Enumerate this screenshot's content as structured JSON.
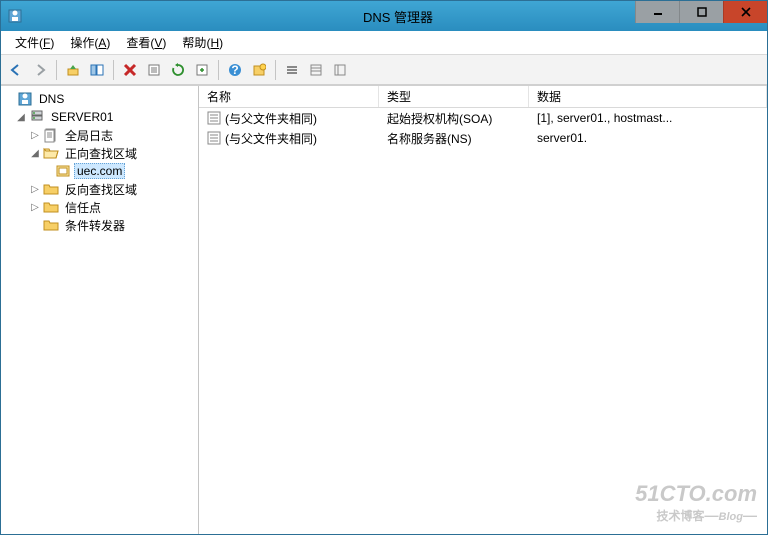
{
  "window": {
    "title": "DNS 管理器"
  },
  "menubar": {
    "file": {
      "label": "文件",
      "key": "F"
    },
    "action": {
      "label": "操作",
      "key": "A"
    },
    "view": {
      "label": "查看",
      "key": "V"
    },
    "help": {
      "label": "帮助",
      "key": "H"
    }
  },
  "tree": {
    "root": "DNS",
    "server": "SERVER01",
    "global_log": "全局日志",
    "fwd_zone": "正向查找区域",
    "zone_uec": "uec.com",
    "rev_zone": "反向查找区域",
    "trust": "信任点",
    "forwarder": "条件转发器"
  },
  "list": {
    "headers": {
      "name": "名称",
      "type": "类型",
      "data": "数据"
    },
    "rows": [
      {
        "name": "(与父文件夹相同)",
        "type": "起始授权机构(SOA)",
        "data": "[1], server01., hostmast..."
      },
      {
        "name": "(与父文件夹相同)",
        "type": "名称服务器(NS)",
        "data": "server01."
      }
    ]
  },
  "watermark": {
    "line1": "51CTO.com",
    "line2": "技术博客",
    "line2_suffix": "Blog"
  }
}
